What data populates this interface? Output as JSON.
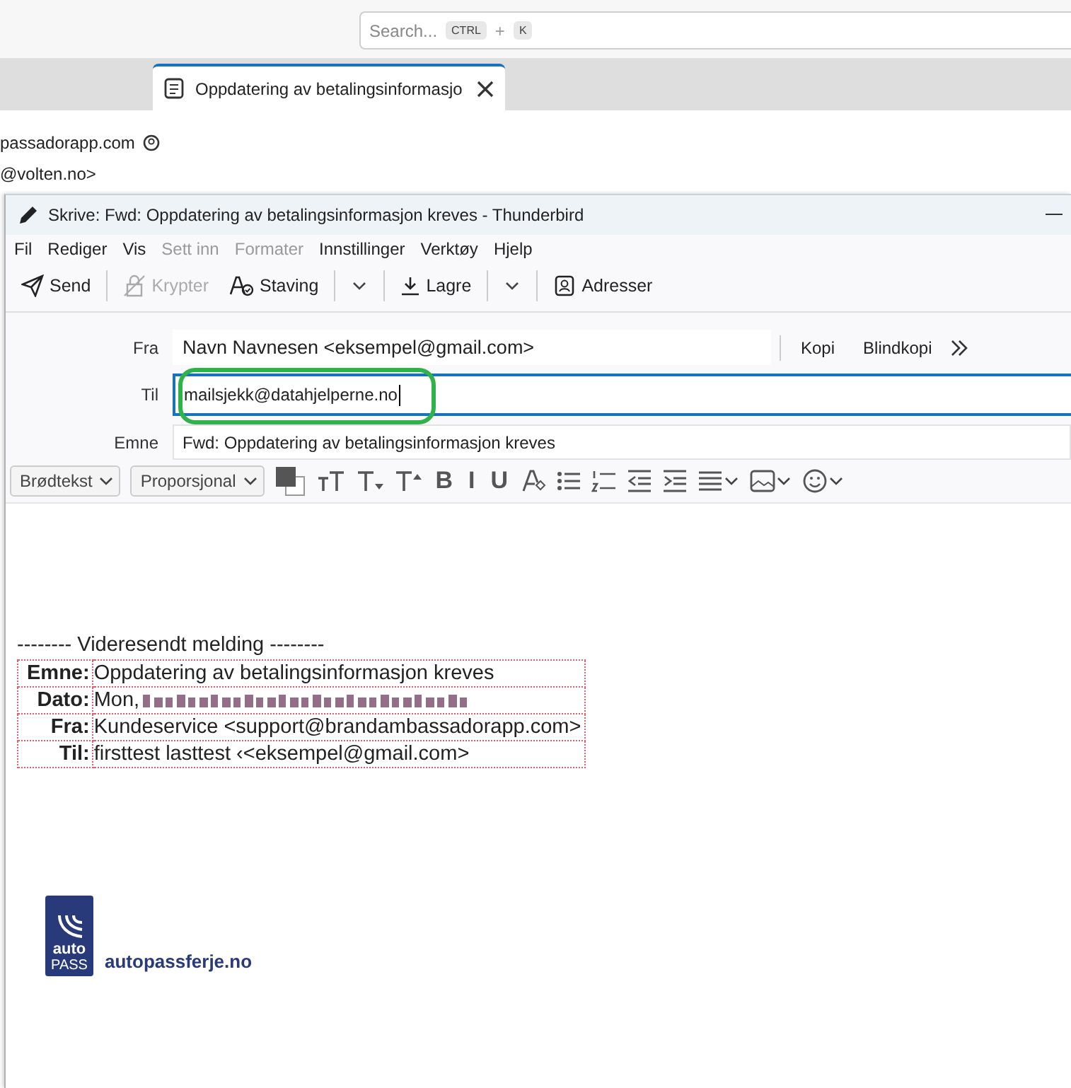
{
  "search": {
    "placeholder": "Search...",
    "keys": [
      "CTRL",
      "K"
    ],
    "joiner": "+"
  },
  "tabs": [
    {
      "title": "Oppdatering av betalingsinformasjo",
      "selected": true
    }
  ],
  "background_lines": [
    "passadorapp.com",
    "@volten.no>"
  ],
  "compose": {
    "title": "Skrive: Fwd: Oppdatering av betalingsinformasjon kreves - Thunderbird",
    "menu": [
      {
        "label": "Fil",
        "disabled": false
      },
      {
        "label": "Rediger",
        "disabled": false
      },
      {
        "label": "Vis",
        "disabled": false
      },
      {
        "label": "Sett inn",
        "disabled": true
      },
      {
        "label": "Formater",
        "disabled": true
      },
      {
        "label": "Innstillinger",
        "disabled": false
      },
      {
        "label": "Verktøy",
        "disabled": false
      },
      {
        "label": "Hjelp",
        "disabled": false
      }
    ],
    "toolbar": [
      {
        "kind": "send",
        "label": "Send",
        "disabled": false
      },
      {
        "kind": "encrypt",
        "label": "Krypter",
        "disabled": true
      },
      {
        "kind": "spelling",
        "label": "Staving",
        "disabled": false
      },
      {
        "kind": "menu"
      },
      {
        "kind": "save",
        "label": "Lagre",
        "disabled": false
      },
      {
        "kind": "menu"
      },
      {
        "kind": "contacts",
        "label": "Adresser",
        "disabled": false
      }
    ],
    "from": {
      "label": "Fra",
      "value": "Navn Navnesen <eksempel@gmail.com>"
    },
    "header_buttons": [
      "Kopi",
      "Blindkopi"
    ],
    "to": {
      "label": "Til",
      "value": "mailsjekk@datahjelperne.no",
      "focused": true,
      "highlighted": true
    },
    "subject": {
      "label": "Emne",
      "value": "Fwd: Oppdatering av betalingsinformasjon kreves"
    },
    "format": {
      "paragraph": "Brødtekst",
      "font": "Proporsjonal",
      "buttons": [
        {
          "kind": "color"
        },
        {
          "kind": "smaller"
        },
        {
          "kind": "size-down"
        },
        {
          "kind": "size-up"
        },
        {
          "kind": "style",
          "label": "B"
        },
        {
          "kind": "style",
          "label": "I"
        },
        {
          "kind": "style",
          "label": "U"
        },
        {
          "kind": "clear"
        },
        {
          "kind": "bullets"
        },
        {
          "kind": "numbers"
        },
        {
          "kind": "outdent"
        },
        {
          "kind": "indent"
        },
        {
          "kind": "align"
        },
        {
          "kind": "image"
        },
        {
          "kind": "emoji"
        }
      ]
    },
    "body": {
      "forward_line": "-------- Videresendt melding --------",
      "headers": [
        {
          "label": "Emne:",
          "value": "Oppdatering av betalingsinformasjon kreves",
          "garbled": false
        },
        {
          "label": "Dato:",
          "value": "Mon,",
          "garbled": true
        },
        {
          "label": "Fra:",
          "value": "Kundeservice <support@brandambassadorapp.com>",
          "garbled": false
        },
        {
          "label": "Til:",
          "value": "firsttest lasttest ‹<eksempel@gmail.com>",
          "garbled": false
        }
      ],
      "logo": {
        "top": "auto",
        "bottom": "PASS",
        "site": "autopassferje.no"
      }
    }
  }
}
